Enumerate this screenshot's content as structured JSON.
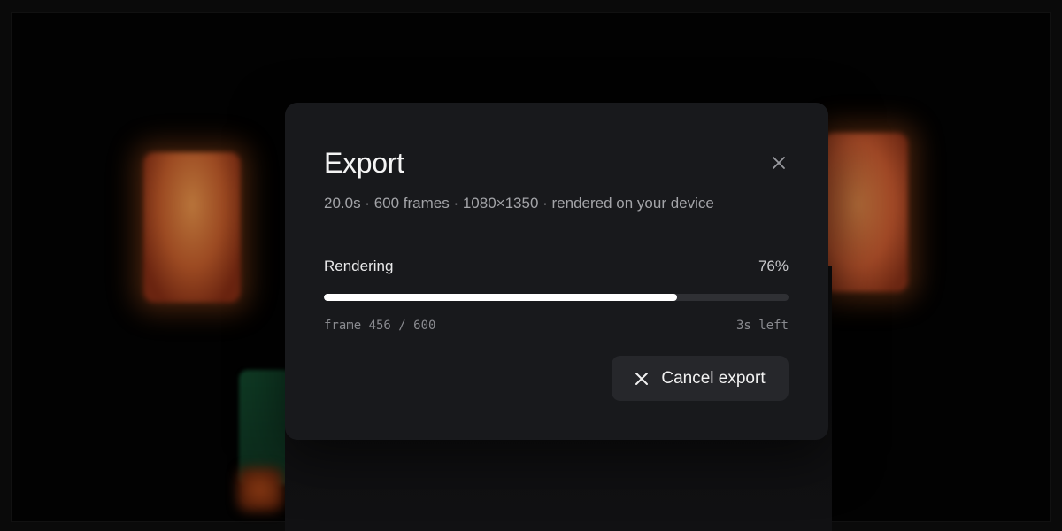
{
  "dialog": {
    "title": "Export",
    "subtitle": "20.0s · 600 frames · 1080×1350 · rendered on your device",
    "close_icon": "close-icon"
  },
  "progress": {
    "label": "Rendering",
    "percent_text": "76%",
    "value": 0.76,
    "frame_text": "frame 456 / 600",
    "time_left": "3s left"
  },
  "actions": {
    "cancel_label": "Cancel export",
    "cancel_icon": "close-icon"
  },
  "colors": {
    "dialog_bg": "#18191c",
    "track": "#2f3034",
    "fill": "#ffffff",
    "button_bg": "#26272b"
  }
}
